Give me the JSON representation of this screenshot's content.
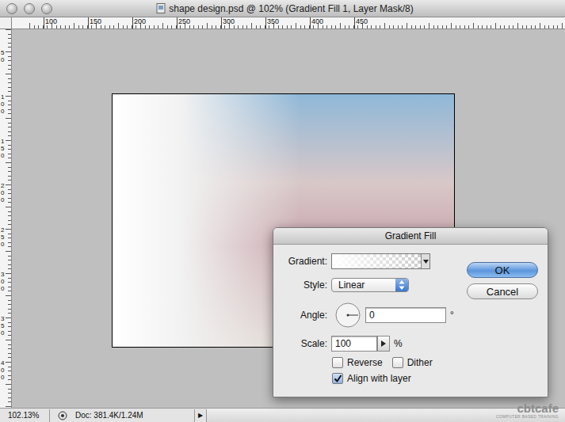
{
  "window": {
    "title": "shape design.psd @ 102% (Gradient Fill 1, Layer Mask/8)"
  },
  "rulers": {
    "top": [
      "100",
      "150",
      "200",
      "250",
      "300",
      "350",
      "400",
      "450"
    ],
    "left": [
      "50",
      "100",
      "150",
      "200",
      "250",
      "300",
      "350",
      "400"
    ]
  },
  "status_bar": {
    "zoom": "102.13%",
    "doc": "Doc: 381.4K/1.24M",
    "arrow": "▶"
  },
  "dialog": {
    "title": "Gradient Fill",
    "gradient_label": "Gradient:",
    "style_label": "Style:",
    "style_value": "Linear",
    "angle_label": "Angle:",
    "angle_value": "0",
    "angle_unit": "°",
    "scale_label": "Scale:",
    "scale_value": "100",
    "scale_unit": "%",
    "checkboxes": [
      {
        "label": "Reverse",
        "checked": false
      },
      {
        "label": "Dither",
        "checked": false
      },
      {
        "label": "Align with layer",
        "checked": true
      }
    ],
    "buttons": [
      {
        "label": "OK",
        "default": true
      },
      {
        "label": "Cancel",
        "default": false
      }
    ]
  },
  "watermark": {
    "logo": "cbtcafe",
    "tagline": "COMPUTER BASED TRAINING"
  }
}
